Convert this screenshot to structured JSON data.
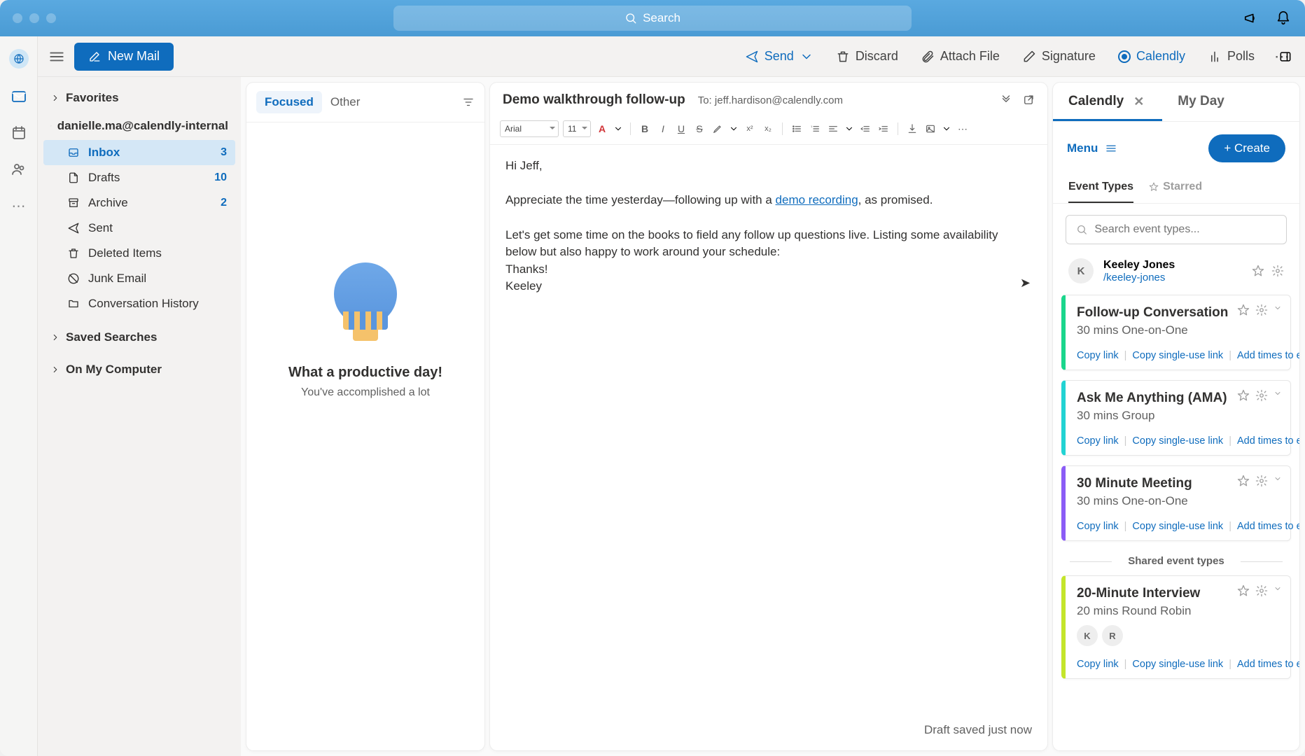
{
  "search_placeholder": "Search",
  "new_mail_label": "New Mail",
  "toolbar": {
    "send": "Send",
    "discard": "Discard",
    "attach": "Attach File",
    "signature": "Signature",
    "calendly": "Calendly",
    "polls": "Polls"
  },
  "folders": {
    "favorites": "Favorites",
    "account": "danielle.ma@calendly-internal",
    "items": [
      {
        "label": "Inbox",
        "count": "3",
        "selected": true,
        "icon": "inbox"
      },
      {
        "label": "Drafts",
        "count": "10",
        "icon": "draft"
      },
      {
        "label": "Archive",
        "count": "2",
        "icon": "archive"
      },
      {
        "label": "Sent",
        "count": "",
        "icon": "sent"
      },
      {
        "label": "Deleted Items",
        "count": "",
        "icon": "trash"
      },
      {
        "label": "Junk Email",
        "count": "",
        "icon": "junk"
      },
      {
        "label": "Conversation History",
        "count": "",
        "icon": "folder"
      }
    ],
    "saved_searches": "Saved Searches",
    "on_my_computer": "On My Computer"
  },
  "msglist": {
    "focused": "Focused",
    "other": "Other",
    "empty_title": "What a productive day!",
    "empty_sub": "You've accomplished a lot"
  },
  "compose": {
    "subject": "Demo walkthrough follow-up",
    "to_label": "To:",
    "to_value": "jeff.hardison@calendly.com",
    "font_name": "Arial",
    "font_size": "11",
    "greeting": "Hi Jeff,",
    "body_before_link": "Appreciate the time yesterday—following up with a ",
    "link_text": "demo recording",
    "body_after_link": ", as promised.",
    "body_p2": "Let's get some time on the books to field any follow up questions live. Listing some availability below but also happy to work around your schedule:",
    "body_thanks": "Thanks!",
    "body_sign": "Keeley",
    "draft_status": "Draft saved just now"
  },
  "sidepanel": {
    "tab_calendly": "Calendly",
    "tab_myday": "My Day",
    "menu": "Menu",
    "create": "+ Create",
    "subtab_event_types": "Event Types",
    "subtab_starred": "Starred",
    "search_placeholder": "Search event types...",
    "user_name": "Keeley Jones",
    "user_slug": "/keeley-jones",
    "user_initial": "K",
    "copy_link": "Copy link",
    "copy_single": "Copy single-use link",
    "add_times": "Add times to email",
    "shared_header": "Shared event types",
    "events": [
      {
        "title": "Follow-up Conversation",
        "meta": "30 mins  One-on-One",
        "color": "#1ad68c"
      },
      {
        "title": "Ask Me Anything (AMA)",
        "meta": "30 mins  Group",
        "color": "#22d3d3"
      },
      {
        "title": "30 Minute Meeting",
        "meta": "30 mins  One-on-One",
        "color": "#8b5cf6"
      }
    ],
    "shared_event": {
      "title": "20-Minute Interview",
      "meta": "20 mins  Round Robin",
      "color": "#c4e52b",
      "avatars": [
        "K",
        "R"
      ]
    }
  }
}
